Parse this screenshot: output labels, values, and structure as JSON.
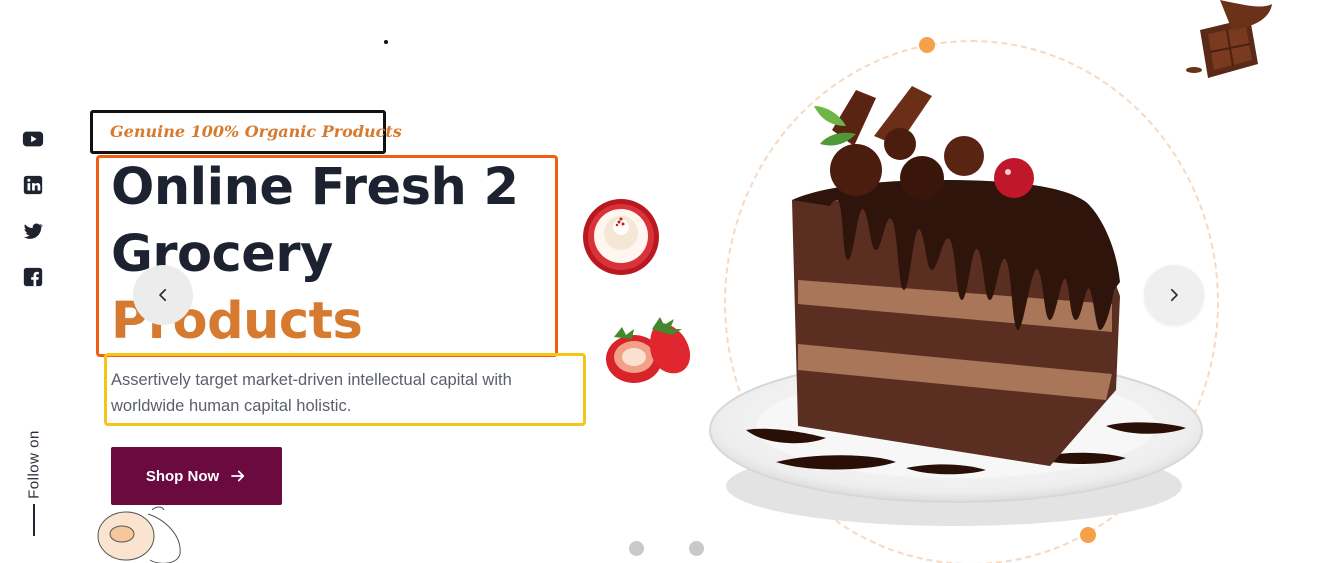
{
  "hero": {
    "tagline": "Genuine 100% Organic Products",
    "title_line1": "Online Fresh 2",
    "title_line2": "Grocery",
    "title_line3": "Products",
    "description": "Assertively target market-driven intellectual capital with worldwide human capital holistic.",
    "cta_label": "Shop Now"
  },
  "social": {
    "follow_label": "Follow on",
    "icons": [
      "youtube-icon",
      "linkedin-icon",
      "twitter-icon",
      "facebook-icon"
    ]
  },
  "slider": {
    "prev_icon": "chevron-left-icon",
    "next_icon": "chevron-right-icon",
    "dot_count": 2
  },
  "colors": {
    "accent": "#d67a2f",
    "button": "#6b0a3e",
    "heading": "#1d2230",
    "tagline_box": "#111111",
    "title_box": "#f25c13",
    "desc_box": "#f5c518"
  }
}
